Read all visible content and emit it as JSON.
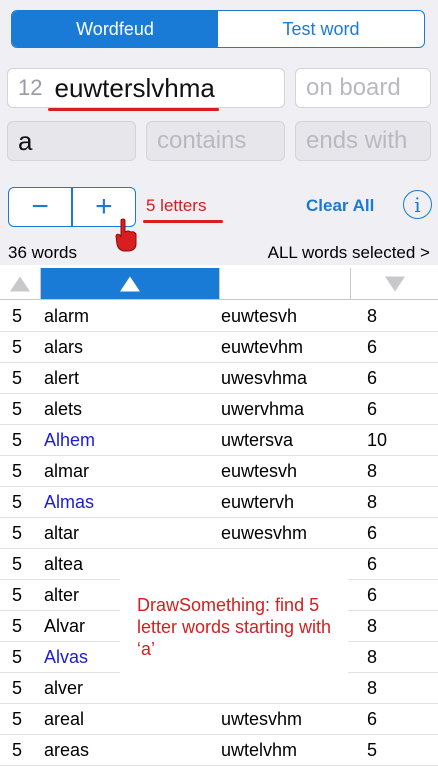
{
  "mode_tabs": [
    {
      "label": "Wordfeud",
      "selected": true
    },
    {
      "label": "Test word",
      "selected": false
    }
  ],
  "letters_field": {
    "count": "12",
    "value": "euwterslvhma"
  },
  "on_board_field": {
    "placeholder": "on board"
  },
  "starts_with_field": {
    "value": "a"
  },
  "contains_field": {
    "placeholder": "contains"
  },
  "ends_with_field": {
    "placeholder": "ends with"
  },
  "stepper": {
    "minus": "−",
    "plus": "+"
  },
  "word_length_label": "5 letters",
  "clear_all_label": "Clear All",
  "info_label": "i",
  "summary": {
    "word_count": "36 words",
    "selected": "ALL words selected >"
  },
  "accent_color": "#1a7bd6",
  "annotation_color": "#d21f1f",
  "rows": [
    {
      "len": "5",
      "word": "alarm",
      "rest": "euwtesvh",
      "score": "8",
      "highlight": false
    },
    {
      "len": "5",
      "word": "alars",
      "rest": "euwtevhm",
      "score": "6",
      "highlight": false
    },
    {
      "len": "5",
      "word": "alert",
      "rest": "uwesvhma",
      "score": "6",
      "highlight": false
    },
    {
      "len": "5",
      "word": "alets",
      "rest": "uwervhma",
      "score": "6",
      "highlight": false
    },
    {
      "len": "5",
      "word": "Alhem",
      "rest": "uwtersva",
      "score": "10",
      "highlight": true
    },
    {
      "len": "5",
      "word": "almar",
      "rest": "euwtesvh",
      "score": "8",
      "highlight": false
    },
    {
      "len": "5",
      "word": "Almas",
      "rest": "euwtervh",
      "score": "8",
      "highlight": true
    },
    {
      "len": "5",
      "word": "altar",
      "rest": "euwesvhm",
      "score": "6",
      "highlight": false
    },
    {
      "len": "5",
      "word": "altea",
      "rest": "",
      "score": "6",
      "highlight": false
    },
    {
      "len": "5",
      "word": "alter",
      "rest": "",
      "score": "6",
      "highlight": false
    },
    {
      "len": "5",
      "word": "Alvar",
      "rest": "",
      "score": "8",
      "highlight": false
    },
    {
      "len": "5",
      "word": "Alvas",
      "rest": "",
      "score": "8",
      "highlight": true
    },
    {
      "len": "5",
      "word": "alver",
      "rest": "",
      "score": "8",
      "highlight": false
    },
    {
      "len": "5",
      "word": "areal",
      "rest": "uwtesvhm",
      "score": "6",
      "highlight": false
    },
    {
      "len": "5",
      "word": "areas",
      "rest": "uwtelvhm",
      "score": "5",
      "highlight": false
    }
  ],
  "annotation_text": "DrawSomething: find 5 letter words starting with ‘a’"
}
